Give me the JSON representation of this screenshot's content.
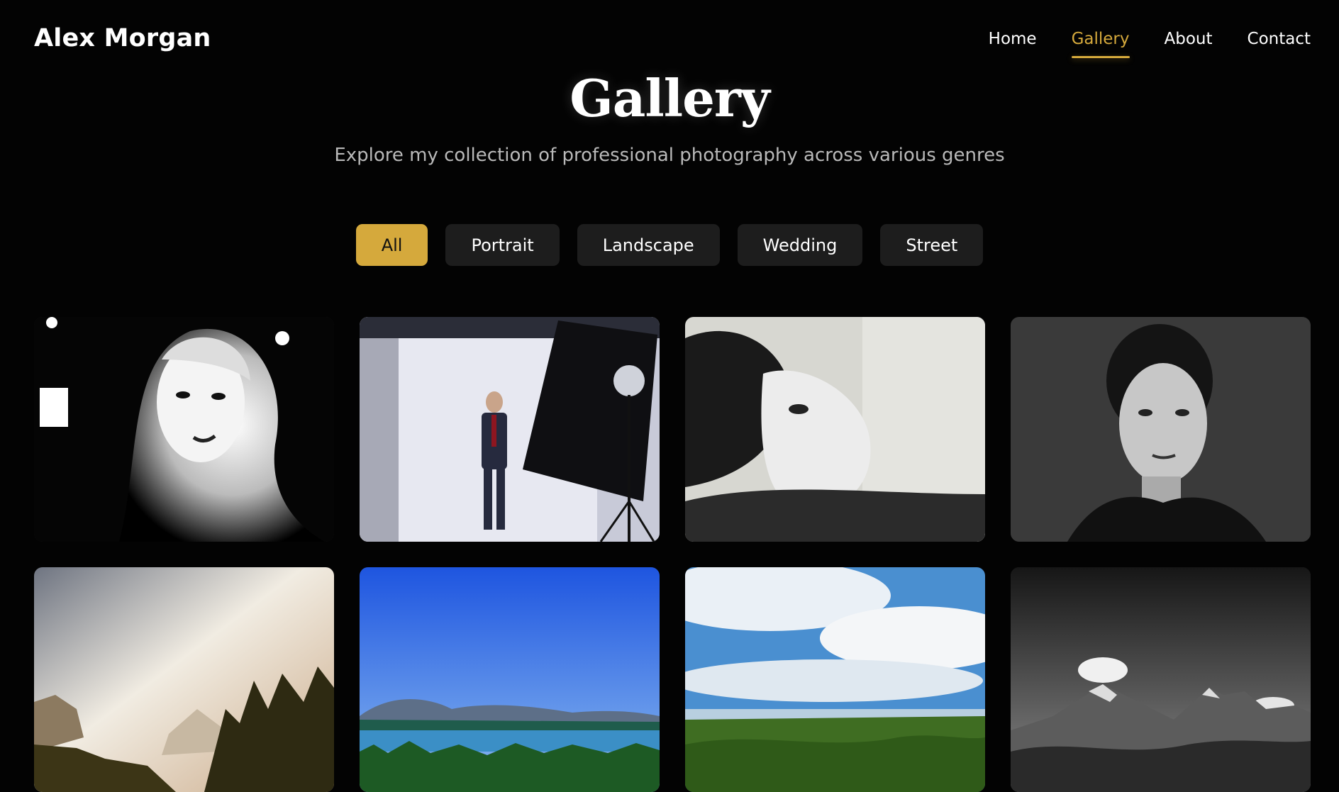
{
  "brand": "Alex Morgan",
  "nav": {
    "items": [
      "Home",
      "Gallery",
      "About",
      "Contact"
    ],
    "active": "Gallery"
  },
  "hero": {
    "title": "Gallery",
    "subtitle": "Explore my collection of professional photography across various genres"
  },
  "filters": {
    "items": [
      "All",
      "Portrait",
      "Landscape",
      "Wedding",
      "Street"
    ],
    "active": "All"
  },
  "colors": {
    "accent": "#d5a93c",
    "background": "#030303",
    "button": "#1d1d1d"
  },
  "gallery": {
    "images": [
      {
        "category": "Portrait",
        "subject": "woman-bw-high-contrast"
      },
      {
        "category": "Portrait",
        "subject": "man-in-suit-studio"
      },
      {
        "category": "Portrait",
        "subject": "young-man-bw"
      },
      {
        "category": "Portrait",
        "subject": "woman-bw-dark-background"
      },
      {
        "category": "Landscape",
        "subject": "trees-cliffs-sky"
      },
      {
        "category": "Landscape",
        "subject": "lake-island-blue-sky"
      },
      {
        "category": "Landscape",
        "subject": "green-valley-clouds"
      },
      {
        "category": "Landscape",
        "subject": "mountains-bw"
      }
    ]
  }
}
